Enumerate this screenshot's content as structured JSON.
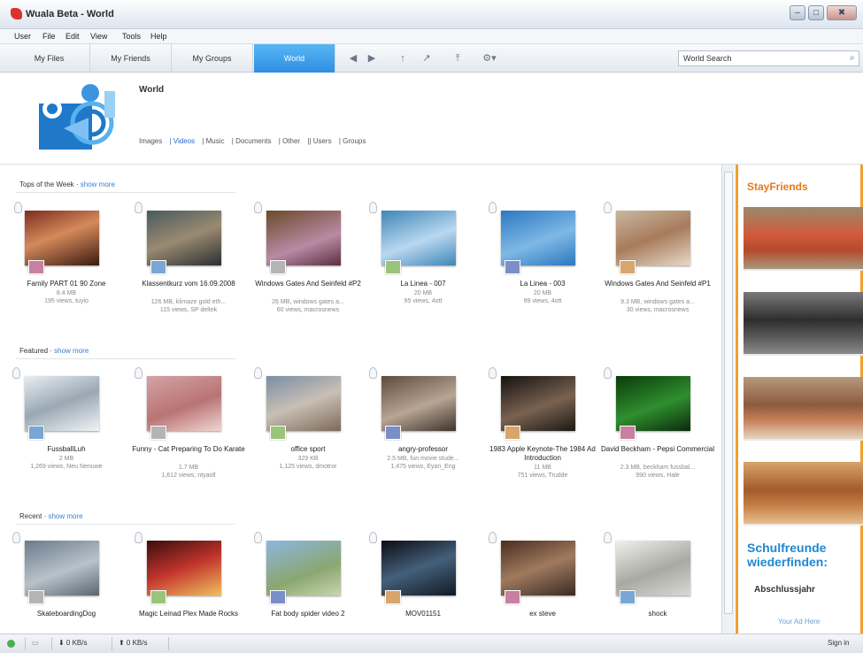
{
  "window": {
    "title": "Wuala Beta - World",
    "controls": [
      "–",
      "□",
      "✖"
    ]
  },
  "menu": [
    "User",
    "File",
    "Edit",
    "View",
    "Tools",
    "Help"
  ],
  "nav": {
    "tabs": [
      {
        "label": "My Files",
        "active": false
      },
      {
        "label": "My Friends",
        "active": false
      },
      {
        "label": "My Groups",
        "active": false
      },
      {
        "label": "World",
        "active": true
      }
    ],
    "buttons": [
      "◀",
      "▶",
      "↑",
      "↗",
      "⤒",
      "⚙▾"
    ],
    "search_value": "World Search",
    "search_icon": "⌕"
  },
  "header": {
    "title": "World",
    "categories": [
      "Images",
      "| Videos",
      "| Music",
      "| Documents",
      "| Other",
      "|| Users",
      "| Groups"
    ],
    "active_category": 1
  },
  "sections": [
    {
      "title": "Tops of the Week",
      "more": "show more",
      "items": [
        {
          "title": "Family PART 01 90 Zone",
          "size": "8.4 MB",
          "stats": "195 views, tuyio"
        },
        {
          "title": "Klassentkurz vom 16.09.2008",
          "size": "",
          "stats": "126 MB, klimaze gold eth...|115 views, SP deltek"
        },
        {
          "title": "Windows Gates And Seinfeld #P2",
          "size": "",
          "stats": "26 MB, windows gates a...|60 views, macrosnews"
        },
        {
          "title": "La Linea - 007",
          "size": "20 MB",
          "stats": "95 views, 4ott"
        },
        {
          "title": "La Linea - 003",
          "size": "20 MB",
          "stats": "99 views, 4ott"
        },
        {
          "title": "Windows Gates And Seinfeld #P1",
          "size": "",
          "stats": "9.3 MB, windows gates a...|30 views, macrosnews"
        }
      ]
    },
    {
      "title": "Featured",
      "more": "show more",
      "items": [
        {
          "title": "FussballLuh",
          "size": "2 MB",
          "stats": "1,269 views, Neu Nenuwe"
        },
        {
          "title": "Funny - Cat Preparing To Do Karate",
          "size": "1.7 MB",
          "stats": "1,612 views, ntyaoll"
        },
        {
          "title": "office sport",
          "size": "329 KB",
          "stats": "1,125 views, dmotror"
        },
        {
          "title": "angry-professor",
          "size": "",
          "stats": "2.5 MB, fun movie stude...|1,475 views, Eyan_Eng"
        },
        {
          "title": "1983 Apple Keynote-The 1984 Ad Introduction",
          "size": "11 MB",
          "stats": "751 views, Trudde"
        },
        {
          "title": "David Beckham - Pepsi Commercial",
          "size": "",
          "stats": "2.3 MB, beckham fussbal...|990 views, Hale"
        }
      ]
    },
    {
      "title": "Recent",
      "more": "show more",
      "items": [
        {
          "title": "SkateboardingDog",
          "size": "",
          "stats": ""
        },
        {
          "title": "Magic Leinad Plex Made Rocks",
          "size": "",
          "stats": ""
        },
        {
          "title": "Fat body spider video 2",
          "size": "",
          "stats": ""
        },
        {
          "title": "MOV01151",
          "size": "",
          "stats": ""
        },
        {
          "title": "ex steve",
          "size": "",
          "stats": ""
        },
        {
          "title": "shock",
          "size": "",
          "stats": ""
        }
      ]
    }
  ],
  "ad": {
    "logo": "StayFriends",
    "headline": "Schulfreunde wiederfinden:",
    "subline": "Abschlussjahr",
    "link": "Your Ad Here"
  },
  "status": {
    "down": "⬇ 0 KB/s",
    "up": "⬆ 0 KB/s",
    "signin": "Sign in"
  },
  "colors": {
    "accent": "#2f8ee1",
    "ad_border": "#f29f2d",
    "link": "#3a7fd0"
  }
}
